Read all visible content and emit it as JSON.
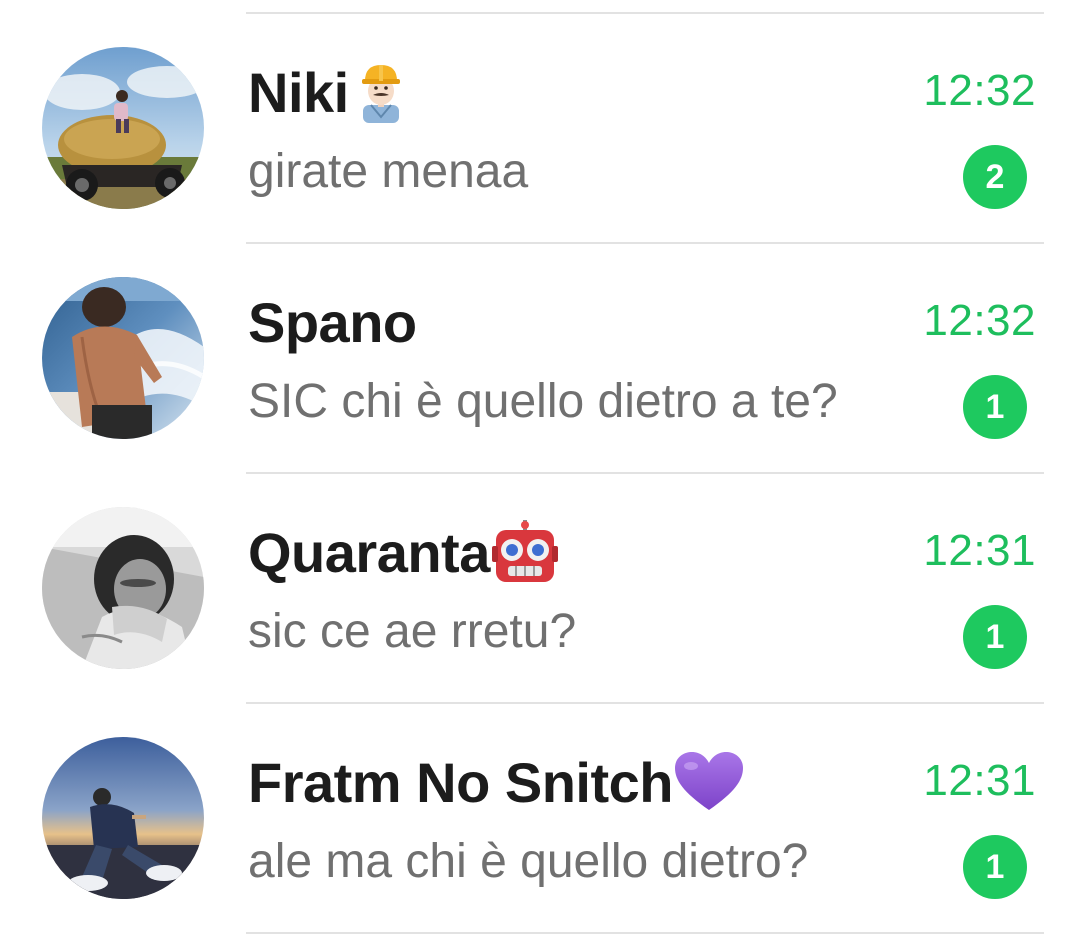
{
  "colors": {
    "accent": "#1ec95f",
    "time_text": "#1ebe5d",
    "name_text": "#1c1c1c",
    "preview_text": "#707070",
    "divider": "#e2e2e2"
  },
  "chats": [
    {
      "name": "Niki",
      "emoji": "construction-worker-emoji",
      "time": "12:32",
      "last_message": "girate menaa",
      "unread_count": "2",
      "avatar": "photo-person-on-motorcycle-hay-bale"
    },
    {
      "name": "Spano",
      "emoji": "",
      "time": "12:32",
      "last_message": "SIC chi è quello dietro a te?",
      "unread_count": "1",
      "avatar": "photo-man-on-boat-sea"
    },
    {
      "name": "Quaranta",
      "emoji": "robot-emoji",
      "time": "12:31",
      "last_message": "sic ce ae rretu?",
      "unread_count": "1",
      "avatar": "photo-black-and-white-person"
    },
    {
      "name": "Fratm No Snitch",
      "emoji": "purple-heart-emoji",
      "time": "12:31",
      "last_message": "ale ma chi è quello dietro?",
      "unread_count": "1",
      "avatar": "photo-person-sitting-sunset"
    }
  ]
}
